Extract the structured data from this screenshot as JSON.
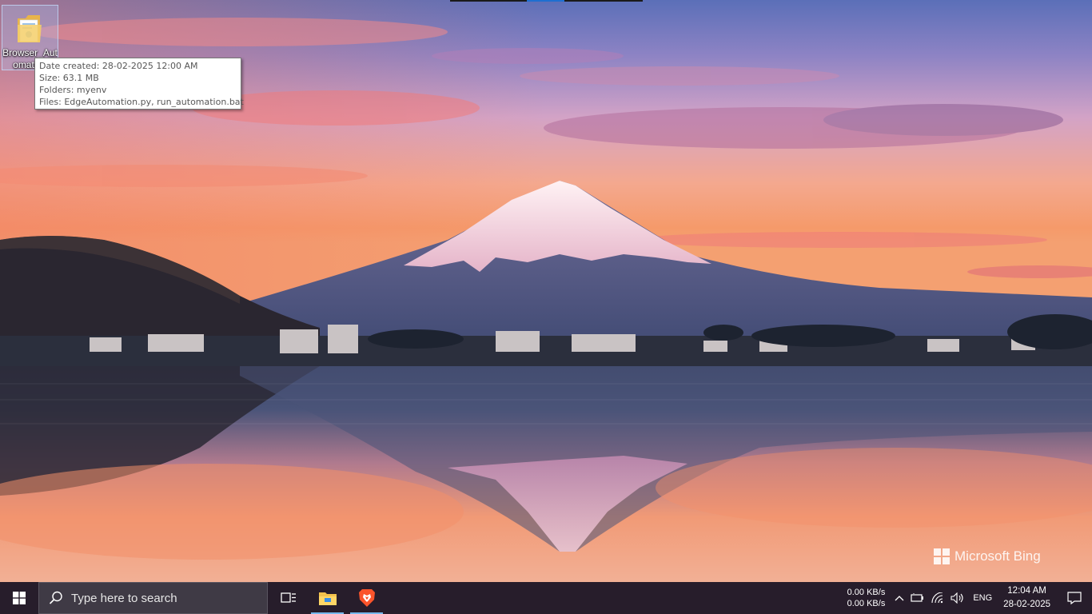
{
  "desktop": {
    "icon": {
      "name_line1": "Browser_Aut",
      "name_line2": "omation",
      "icon_name": "folder-icon"
    },
    "tooltip": {
      "date_created": "Date created: 28-02-2025 12:00 AM",
      "size": "Size: 63.1 MB",
      "folders": "Folders: myenv",
      "files": "Files: EdgeAutomation.py, run_automation.bat"
    },
    "watermark": "Microsoft Bing"
  },
  "taskbar": {
    "search_placeholder": "Type here to search",
    "apps": [
      "task-view-icon",
      "file-explorer-icon",
      "brave-browser-icon"
    ],
    "network_speed_up": "0.00 KB/s",
    "network_speed_down": "0.00 KB/s",
    "language": "ENG",
    "time": "12:04 AM",
    "date": "28-02-2025"
  },
  "colors": {
    "taskbar_bg": "#271d2b",
    "search_bg": "#3f3a45",
    "active_indicator": "#76b9ed"
  }
}
